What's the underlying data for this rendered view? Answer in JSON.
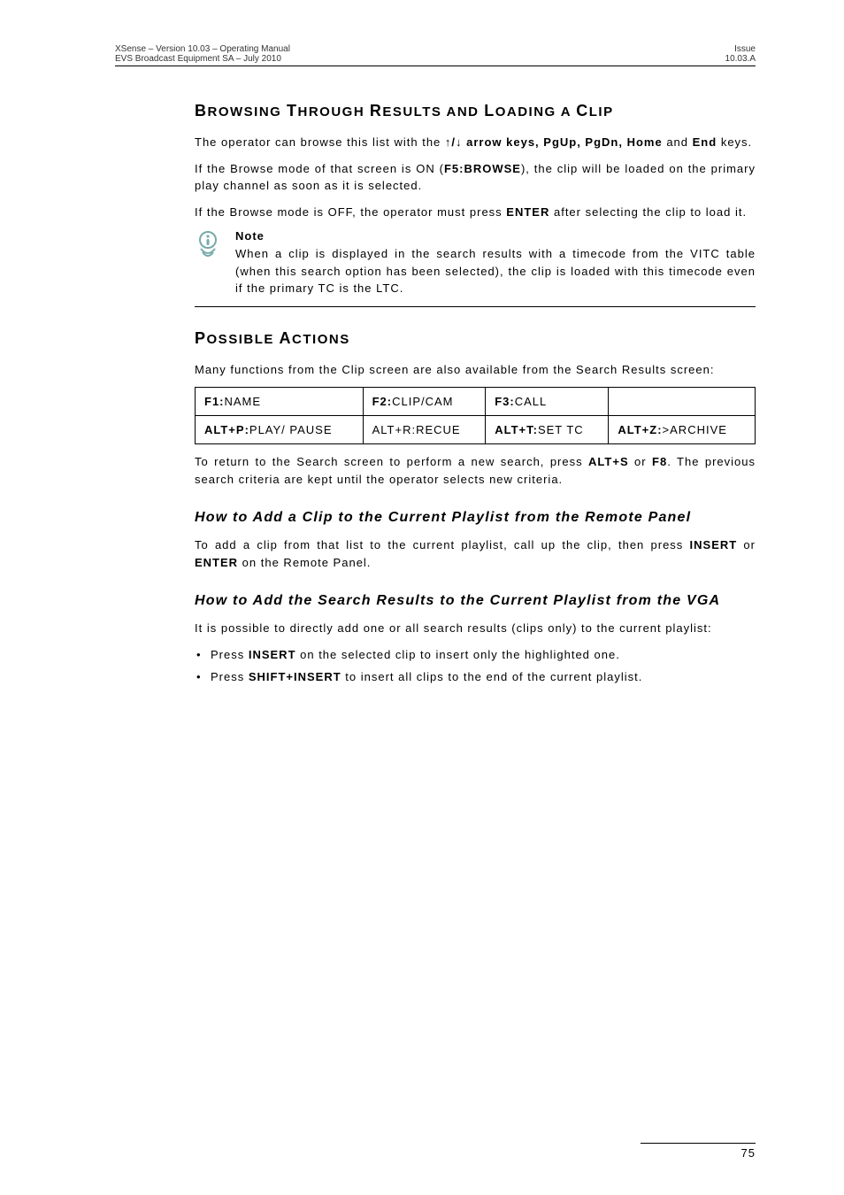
{
  "header": {
    "left_line1": "XSense – Version 10.03 – Operating Manual",
    "left_line2": "EVS Broadcast Equipment SA – July 2010",
    "right_line1": "Issue",
    "right_line2": "10.03.A"
  },
  "section1": {
    "heading_pre": "B",
    "heading_mid1": "ROWSING ",
    "heading_t": "T",
    "heading_mid2": "HROUGH ",
    "heading_r": "R",
    "heading_mid3": "ESULTS AND ",
    "heading_l": "L",
    "heading_mid4": "OADING A ",
    "heading_c": "C",
    "heading_mid5": "LIP",
    "p1_a": "The operator can browse this list with the ",
    "p1_b": "↑/↓ arrow keys, PgUp, PgDn, Home",
    "p1_c": " and ",
    "p1_d": "End",
    "p1_e": " keys.",
    "p2_a": "If the Browse mode of that screen is ON (",
    "p2_b": "F5:BROWSE",
    "p2_c": "), the clip will be loaded on the primary play channel as soon as it is selected.",
    "p3_a": "If the Browse mode is OFF, the operator must press ",
    "p3_b": "ENTER",
    "p3_c": " after selecting the clip to load it.",
    "note_title": "Note",
    "note_body": "When a clip is displayed in the search results with a timecode from the VITC table (when this search option has been selected), the clip is loaded with this timecode even if the primary TC is the LTC."
  },
  "section2": {
    "heading_p": "P",
    "heading_mid1": "OSSIBLE ",
    "heading_a": "A",
    "heading_mid2": "CTIONS",
    "p1": "Many functions from the Clip screen are also available from the Search Results screen:",
    "table": {
      "r1": {
        "c1_b": "F1:",
        "c1_t": "NAME",
        "c2_b": "F2:",
        "c2_t": "CLIP/CAM",
        "c3_b": "F3:",
        "c3_t": "CALL",
        "c4": ""
      },
      "r2": {
        "c1_b": "ALT+P:",
        "c1_t": "PLAY/ PAUSE",
        "c2": "ALT+R:RECUE",
        "c3_b": "ALT+T:",
        "c3_t": "SET TC",
        "c4_b": "ALT+Z:",
        "c4_t": ">ARCHIVE"
      }
    },
    "p2_a": "To return to the Search screen to perform a new search, press ",
    "p2_b": "ALT+S",
    "p2_c": " or ",
    "p2_d": "F8",
    "p2_e": ". The previous search criteria are kept until the operator selects new criteria."
  },
  "section3": {
    "heading": "How to Add a Clip to the Current Playlist from the Remote Panel",
    "p1_a": "To add a clip from that list to the current playlist, call up the clip, then press ",
    "p1_b": "INSERT",
    "p1_c": " or ",
    "p1_d": "ENTER",
    "p1_e": " on the Remote Panel."
  },
  "section4": {
    "heading": "How to Add the Search Results to the Current Playlist from the VGA",
    "p1": "It is possible to directly add one or all search results (clips only) to the current playlist:",
    "b1_a": "Press ",
    "b1_b": "INSERT",
    "b1_c": " on the selected clip to insert only the highlighted one.",
    "b2_a": "Press ",
    "b2_b": "SHIFT+INSERT",
    "b2_c": " to insert all clips to the end of the current playlist."
  },
  "footer": {
    "page": "75"
  }
}
